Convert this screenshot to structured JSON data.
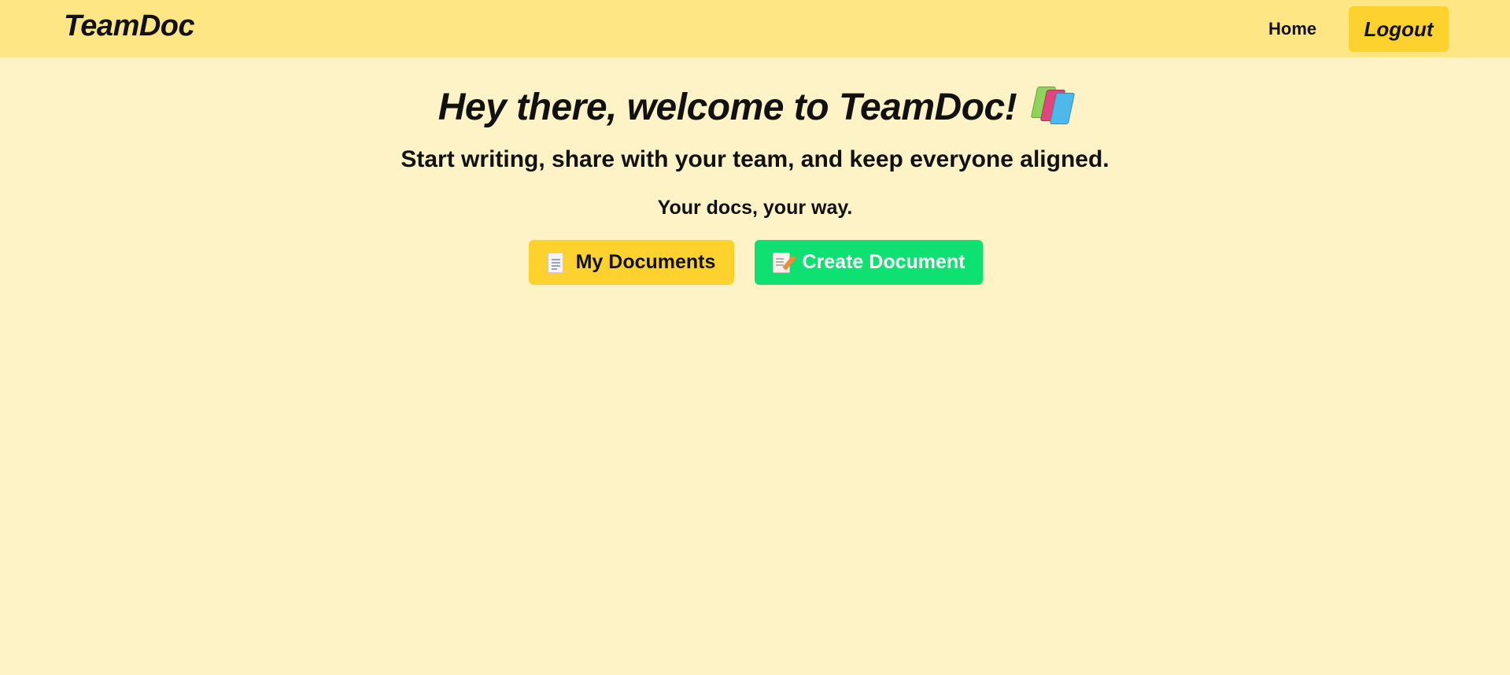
{
  "navbar": {
    "brand": "TeamDoc",
    "home_label": "Home",
    "logout_label": "Logout"
  },
  "hero": {
    "title": "Hey there, welcome to TeamDoc!",
    "title_icon": "books-icon",
    "subtitle": "Start writing, share with your team, and keep everyone aligned.",
    "tagline": "Your docs, your way."
  },
  "actions": {
    "my_documents": {
      "label": "My Documents",
      "icon": "document-icon"
    },
    "create_document": {
      "label": "Create Document",
      "icon": "memo-icon"
    }
  },
  "colors": {
    "page_background": "#fef3c6",
    "navbar_background": "#ffe685",
    "accent_yellow": "#fdd22f",
    "accent_green": "#0ee172"
  }
}
